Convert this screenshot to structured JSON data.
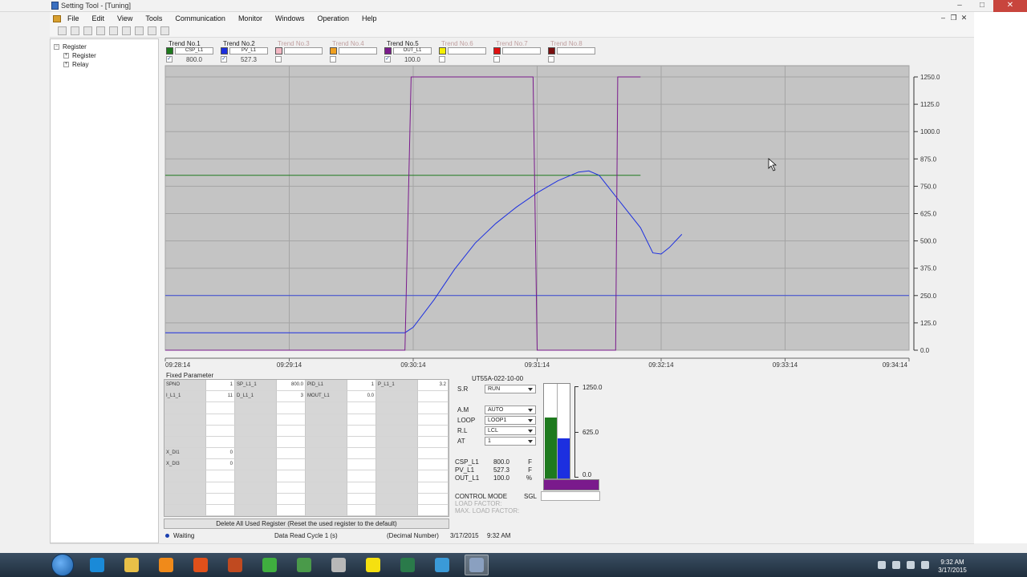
{
  "window": {
    "title": "Setting Tool - [Tuning]"
  },
  "menu": [
    "File",
    "Edit",
    "View",
    "Tools",
    "Communication",
    "Monitor",
    "Windows",
    "Operation",
    "Help"
  ],
  "tree": {
    "root": "Register",
    "children": [
      "Register",
      "Relay"
    ]
  },
  "trends": [
    {
      "label": "Trend No.1",
      "name": "CSP_L1",
      "value": "800.0",
      "color": "#1e7a1e",
      "checked": true,
      "active": true
    },
    {
      "label": "Trend No.2",
      "name": "PV_L1",
      "value": "527.3",
      "color": "#1c2fe0",
      "checked": true,
      "active": true
    },
    {
      "label": "Trend No.3",
      "name": "",
      "value": "",
      "color": "#f4b8c4",
      "checked": false,
      "active": false
    },
    {
      "label": "Trend No.4",
      "name": "",
      "value": "",
      "color": "#f0a020",
      "checked": false,
      "active": false
    },
    {
      "label": "Trend No.5",
      "name": "OUT_L1",
      "value": "100.0",
      "color": "#7a1a8c",
      "checked": true,
      "active": true
    },
    {
      "label": "Trend No.6",
      "name": "",
      "value": "",
      "color": "#f5f000",
      "checked": false,
      "active": false
    },
    {
      "label": "Trend No.7",
      "name": "",
      "value": "",
      "color": "#e01010",
      "checked": false,
      "active": false
    },
    {
      "label": "Trend No.8",
      "name": "",
      "value": "",
      "color": "#7a1010",
      "checked": false,
      "active": false
    }
  ],
  "chart_data": {
    "type": "line",
    "x_ticks": [
      "09:28:14",
      "09:29:14",
      "09:30:14",
      "09:31:14",
      "09:32:14",
      "09:33:14",
      "09:34:14"
    ],
    "y_ticks": [
      "1250.0",
      "1125.0",
      "1000.0",
      "875.0",
      "750.0",
      "625.0",
      "500.0",
      "375.0",
      "250.0",
      "125.0",
      "0.0"
    ],
    "ylim": [
      0,
      1250
    ],
    "x_unit": "seconds after 09:28:14",
    "xlim": [
      0,
      360
    ],
    "series": [
      {
        "name": "CSP_L1",
        "color": "#1e7a1e",
        "x": [
          0,
          230
        ],
        "y": [
          800,
          800
        ]
      },
      {
        "name": "PV_L1",
        "color": "#1c2fe0",
        "x": [
          0,
          116,
          120,
          130,
          140,
          150,
          160,
          170,
          180,
          190,
          200,
          205,
          210,
          220,
          230,
          236,
          240,
          244,
          250
        ],
        "y": [
          80,
          80,
          105,
          230,
          370,
          490,
          580,
          655,
          720,
          775,
          815,
          820,
          800,
          680,
          560,
          445,
          440,
          470,
          530
        ]
      },
      {
        "name": "OUT_L1",
        "color": "#7a1a8c",
        "x": [
          0,
          116,
          119,
          178,
          180,
          218,
          219,
          230
        ],
        "y": [
          0,
          0,
          1250,
          1250,
          0,
          0,
          1250,
          1250
        ]
      }
    ],
    "pv_reference_line": 250
  },
  "fixed_parameter": {
    "title": "Fixed Parameter",
    "rows": [
      [
        "SPNO",
        "1",
        "SP_L1_1",
        "800.0",
        "PID_L1",
        "1",
        "P_L1_1",
        "3.2"
      ],
      [
        "I_L1_1",
        "11",
        "D_L1_1",
        "3",
        "MOUT_L1",
        "0.0",
        "",
        ""
      ],
      [
        "",
        "",
        "",
        "",
        "",
        "",
        "",
        ""
      ],
      [
        "",
        "",
        "",
        "",
        "",
        "",
        "",
        ""
      ],
      [
        "",
        "",
        "",
        "",
        "",
        "",
        "",
        ""
      ],
      [
        "",
        "",
        "",
        "",
        "",
        "",
        "",
        ""
      ],
      [
        "X_DI1",
        "0",
        "",
        "",
        "",
        "",
        "",
        ""
      ],
      [
        "X_DI3",
        "0",
        "",
        "",
        "",
        "",
        "",
        ""
      ],
      [
        "",
        "",
        "",
        "",
        "",
        "",
        "",
        ""
      ],
      [
        "",
        "",
        "",
        "",
        "",
        "",
        "",
        ""
      ],
      [
        "",
        "",
        "",
        "",
        "",
        "",
        "",
        ""
      ],
      [
        "",
        "",
        "",
        "",
        "",
        "",
        "",
        ""
      ]
    ],
    "delete_button": "Delete All Used Register (Reset the used register to the default)"
  },
  "controller": {
    "model": "UT55A-022-10-00",
    "sr": {
      "label": "S.R",
      "value": "RUN"
    },
    "am": {
      "label": "A.M",
      "value": "AUTO"
    },
    "loop": {
      "label": "LOOP",
      "value": "LOOP1"
    },
    "rl": {
      "label": "R.L",
      "value": "LCL"
    },
    "at": {
      "label": "AT",
      "value": "1"
    },
    "values": [
      {
        "name": "CSP_L1",
        "value": "800.0",
        "unit": "F"
      },
      {
        "name": "PV_L1",
        "value": "527.3",
        "unit": "F"
      },
      {
        "name": "OUT_L1",
        "value": "100.0",
        "unit": "%"
      }
    ],
    "control_mode_label": "CONTROL MODE",
    "control_mode_value": "SGL",
    "load_factor": "LOAD FACTOR:",
    "max_load_factor": "MAX. LOAD FACTOR:",
    "bar_scale": [
      "1250.0",
      "625.0",
      "0.0"
    ],
    "bar_levels": {
      "csp": 0.64,
      "pv": 0.42,
      "out": 1.0
    }
  },
  "status": {
    "state": "Waiting",
    "cycle": "Data Read Cycle 1 (s)",
    "format": "(Decimal Number)",
    "date": "3/17/2015",
    "time": "9:32 AM"
  },
  "taskbar": {
    "clock_time": "9:32 AM",
    "clock_date": "3/17/2015",
    "apps": [
      {
        "name": "ie-icon",
        "color": "#1a8ad8"
      },
      {
        "name": "explorer-icon",
        "color": "#e8c048"
      },
      {
        "name": "media-player-icon",
        "color": "#f08a1a"
      },
      {
        "name": "firefox-icon",
        "color": "#e0501a"
      },
      {
        "name": "presentation-icon",
        "color": "#c04a20"
      },
      {
        "name": "chrome-icon",
        "color": "#3fae3f"
      },
      {
        "name": "network-tool-icon",
        "color": "#4a9a4a"
      },
      {
        "name": "tools-icon",
        "color": "#b8b8b8"
      },
      {
        "name": "sticky-app-icon",
        "color": "#f5e010"
      },
      {
        "name": "terminal-app-icon",
        "color": "#2a7a4a"
      },
      {
        "name": "chart-app-icon",
        "color": "#3a9ad8"
      },
      {
        "name": "setting-tool-icon",
        "color": "#8aa0c0"
      }
    ]
  }
}
